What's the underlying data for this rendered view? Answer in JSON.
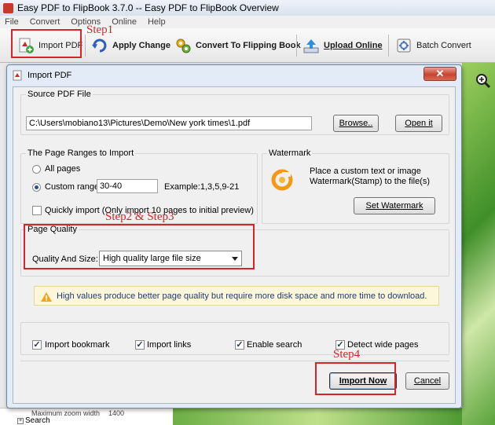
{
  "app": {
    "title": "Easy PDF to FlipBook 3.7.0  -- Easy PDF to FlipBook Overview",
    "menu": [
      "File",
      "Convert",
      "Options",
      "Online",
      "Help"
    ]
  },
  "toolbar": {
    "import_pdf": "Import PDF",
    "apply_change": "Apply Change",
    "convert": "Convert To Flipping Book",
    "upload": "Upload Online",
    "batch": "Batch Convert"
  },
  "annotations": {
    "step1": "Step1",
    "step2": "Step2 & Step3",
    "step4": "Step4"
  },
  "dialog": {
    "title": "Import PDF",
    "source": {
      "title": "Source PDF File",
      "path": "C:\\Users\\mobiano13\\Pictures\\Demo\\New york times\\1.pdf",
      "browse": "Browse..",
      "open": "Open it"
    },
    "ranges": {
      "title": "The Page Ranges to Import",
      "all_pages": "All pages",
      "custom_range": "Custom range:",
      "custom_value": "30-40",
      "example": "Example:1,3,5,9-21",
      "quick_import": "Quickly import (Only import 10 pages to  initial  preview)"
    },
    "watermark": {
      "title": "Watermark",
      "desc_line1": "Place a custom text or image",
      "desc_line2": "Watermark(Stamp) to the file(s)",
      "button": "Set Watermark"
    },
    "quality": {
      "title": "Page Quality",
      "label": "Quality And Size:",
      "selected": "High quality large file size"
    },
    "notice": "High values produce better page quality but require more disk space and more time to download.",
    "options": {
      "import_bookmark": "Import bookmark",
      "import_links": "Import links",
      "enable_search": "Enable search",
      "detect_wide": "Detect wide pages"
    },
    "import_now": "Import Now",
    "cancel": "Cancel"
  },
  "background": {
    "zoom_label": "Maximum zoom width",
    "zoom_value": "1400",
    "search": "Search"
  },
  "colors": {
    "annotation_red": "#d8232a",
    "titlebar": "#e3ecf6",
    "notice_bg": "#fcf7da",
    "notice_text": "#1f3a78"
  }
}
